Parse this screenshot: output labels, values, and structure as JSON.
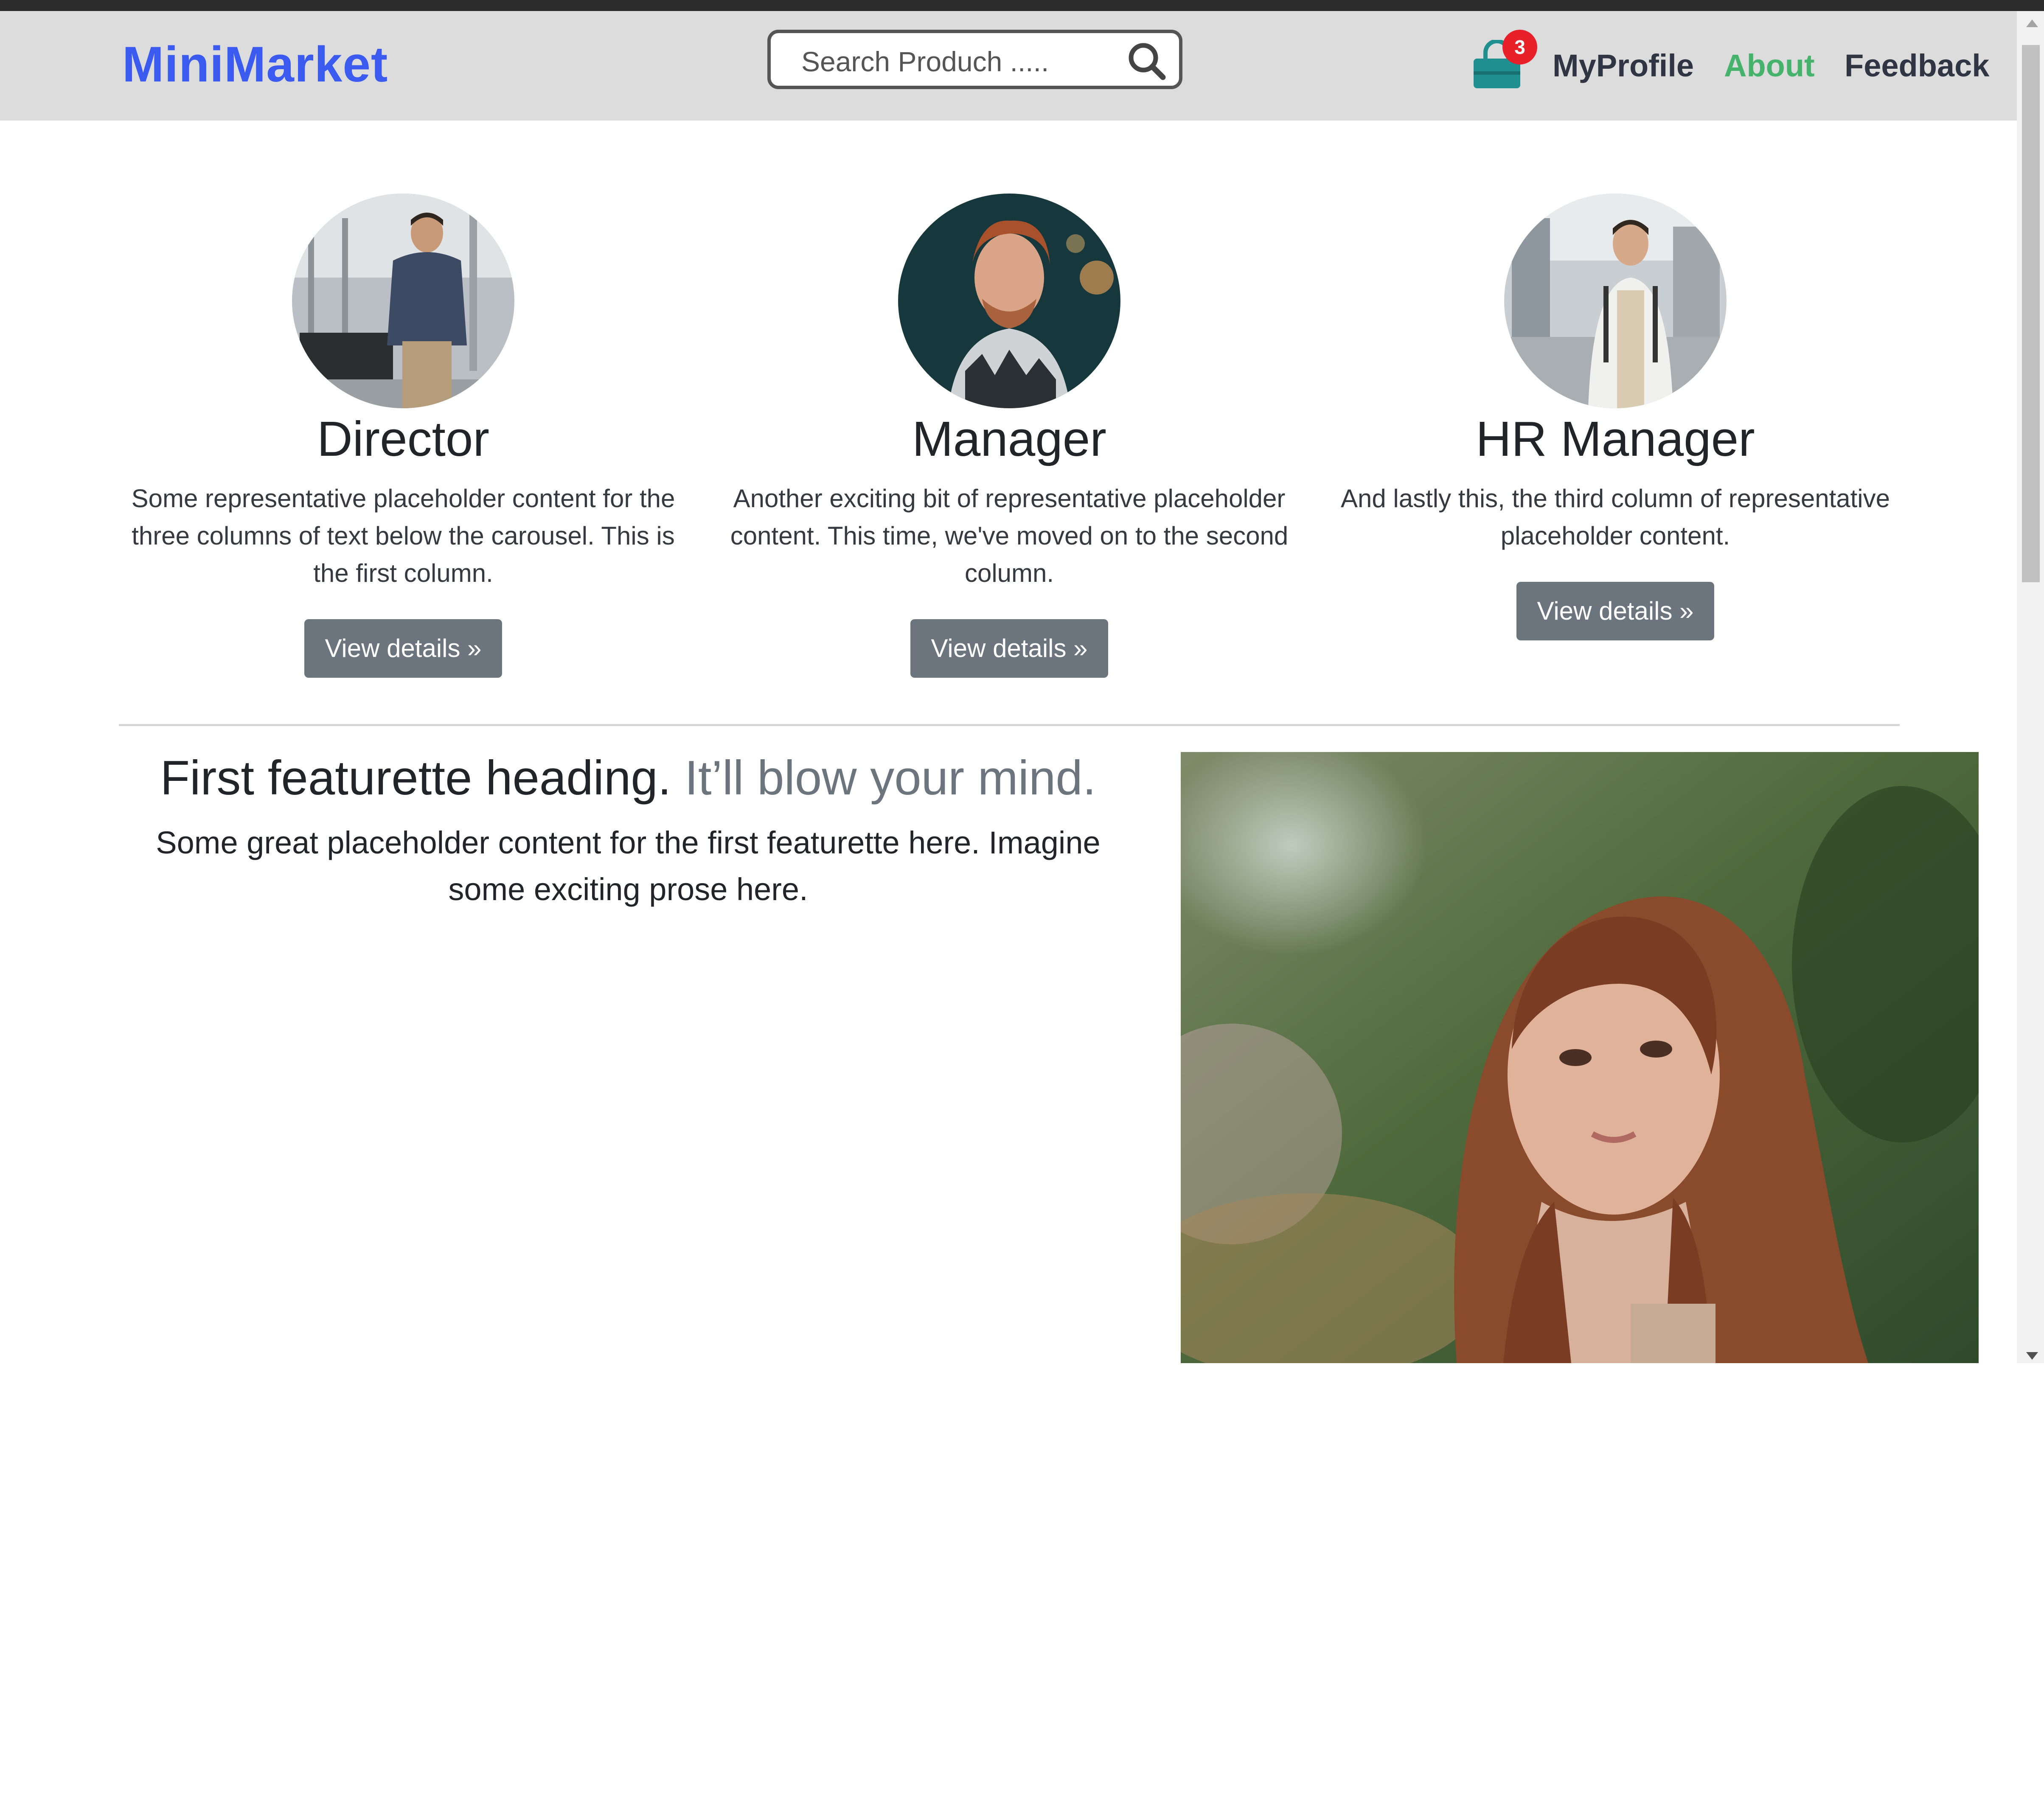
{
  "navbar": {
    "brand": "MiniMarket",
    "search_placeholder": "Search Produch .....",
    "cart_count": "3",
    "links": [
      "MyProfile",
      "About",
      "Feedback"
    ],
    "active_link": "About"
  },
  "team": [
    {
      "title": "Director",
      "text": "Some representative placeholder content for the three columns of text below the carousel. This is the first column.",
      "button": "View details »"
    },
    {
      "title": "Manager",
      "text": "Another exciting bit of representative placeholder content. This time, we've moved on to the second column.",
      "button": "View details »"
    },
    {
      "title": "HR Manager",
      "text": "And lastly this, the third column of representative placeholder content.",
      "button": "View details »"
    }
  ],
  "featurette": {
    "heading": "First featurette heading.",
    "heading_muted": "It’ll blow your mind.",
    "lead": "Some great placeholder content for the first featurette here. Imagine some exciting prose here."
  },
  "colors": {
    "brand": "#3b5bf0",
    "active_link": "#45b36b",
    "cart_icon": "#1f8f8f",
    "badge": "#e8202a",
    "button": "#6c757d"
  },
  "icons": [
    "search-icon",
    "shopping-bag-icon"
  ]
}
